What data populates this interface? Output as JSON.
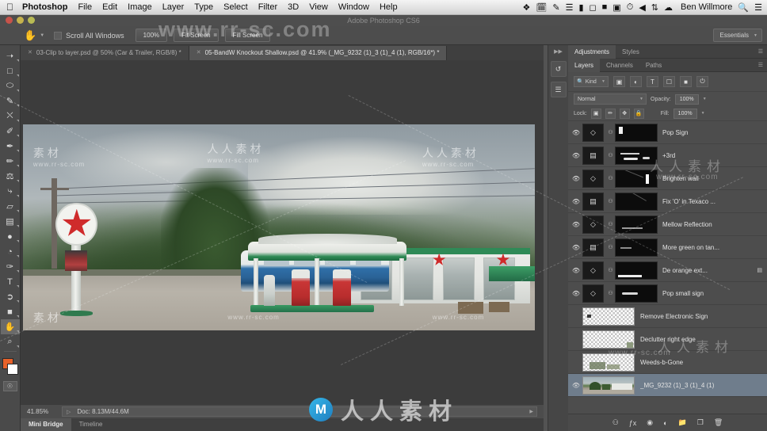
{
  "menubar": {
    "apple_icon": "apple-icon",
    "items": [
      "Photoshop",
      "File",
      "Edit",
      "Image",
      "Layer",
      "Type",
      "Select",
      "Filter",
      "3D",
      "View",
      "Window",
      "Help"
    ],
    "status_icons": [
      "dropbox-icon",
      "calendar-icon",
      "notes-icon",
      "display-icon",
      "battery-icon",
      "cloud-icon",
      "screenshot-icon",
      "clock-icon",
      "volume-icon",
      "bluetooth-icon",
      "wifi-icon"
    ],
    "user": "Ben Willmore",
    "search_icon": "search-icon",
    "notification_icon": "notification-center-icon"
  },
  "app_title": "Adobe Photoshop CS6",
  "options_bar": {
    "tool_icon": "hand-tool-icon",
    "scroll_all_windows_label": "Scroll All Windows",
    "buttons": [
      "100%",
      "Fit Screen",
      "Fill Screen"
    ],
    "workspace": "Essentials"
  },
  "toolbar": {
    "tools": [
      {
        "name": "move-tool",
        "glyph": "↖"
      },
      {
        "name": "marquee-tool",
        "glyph": "⬚"
      },
      {
        "name": "lasso-tool",
        "glyph": "⬭"
      },
      {
        "name": "quick-selection-tool",
        "glyph": "✎"
      },
      {
        "name": "crop-tool",
        "glyph": "⛶"
      },
      {
        "name": "eyedropper-tool",
        "glyph": "✐"
      },
      {
        "name": "spot-healing-brush-tool",
        "glyph": "✒"
      },
      {
        "name": "brush-tool",
        "glyph": "✏"
      },
      {
        "name": "clone-stamp-tool",
        "glyph": "⚓"
      },
      {
        "name": "history-brush-tool",
        "glyph": "⤳"
      },
      {
        "name": "eraser-tool",
        "glyph": "▱"
      },
      {
        "name": "gradient-tool",
        "glyph": "▤"
      },
      {
        "name": "blur-tool",
        "glyph": "●"
      },
      {
        "name": "dodge-tool",
        "glyph": "◔"
      },
      {
        "name": "pen-tool",
        "glyph": "✑"
      },
      {
        "name": "type-tool",
        "glyph": "T"
      },
      {
        "name": "path-selection-tool",
        "glyph": "↖"
      },
      {
        "name": "rectangle-tool",
        "glyph": "■"
      },
      {
        "name": "hand-tool",
        "glyph": "✋"
      },
      {
        "name": "zoom-tool",
        "glyph": "⌕"
      }
    ],
    "foreground_color": "#e8622a",
    "background_color": "#ffffff",
    "quickmask_icon": "quick-mask-icon"
  },
  "tabs": [
    {
      "title": "03-Clip to layer.psd @ 50% (Car & Trailer, RGB/8) *",
      "active": false
    },
    {
      "title": "05-BandW Knockout Shallow.psd @ 41.9% (_MG_9232 (1)_3 (1)_4 (1), RGB/16*) *",
      "active": true
    }
  ],
  "status_bar": {
    "zoom": "41.85%",
    "doc_info": "Doc: 8.13M/44.6M"
  },
  "bottom_tabs": [
    {
      "label": "Mini Bridge",
      "active": true
    },
    {
      "label": "Timeline",
      "active": false
    }
  ],
  "dock_strip": {
    "collapse_icon": "collapse-panels-icon",
    "buttons": [
      "history-panel-icon",
      "properties-panel-icon"
    ]
  },
  "panels": {
    "top_tabs": [
      {
        "label": "Adjustments",
        "active": true
      },
      {
        "label": "Styles",
        "active": false
      }
    ],
    "layer_tabs": [
      {
        "label": "Layers",
        "active": true
      },
      {
        "label": "Channels",
        "active": false
      },
      {
        "label": "Paths",
        "active": false
      }
    ],
    "menu_icon": "panel-menu-icon",
    "filter": {
      "kind_label": "Kind",
      "search_icon": "search-icon",
      "filter_icons": [
        "pixel-filter-icon",
        "adjustment-filter-icon",
        "type-filter-icon",
        "shape-filter-icon",
        "smart-object-filter-icon",
        "toggle-filter-icon"
      ]
    },
    "blend": {
      "mode": "Normal",
      "opacity_label": "Opacity:",
      "opacity_value": "100%"
    },
    "lock": {
      "label": "Lock:",
      "icons": [
        "lock-transparency-icon",
        "lock-image-icon",
        "lock-position-icon",
        "lock-all-icon"
      ],
      "fill_label": "Fill:",
      "fill_value": "100%"
    },
    "layers": [
      {
        "name": "Pop Sign",
        "type": "adjustment",
        "icon": "curves-icon",
        "visible": true,
        "linked": true,
        "masked": true,
        "selected": false
      },
      {
        "name": "+3rd",
        "type": "adjustment",
        "icon": "levels-icon",
        "visible": true,
        "linked": true,
        "masked": true,
        "selected": false
      },
      {
        "name": "Brighten wall",
        "type": "adjustment",
        "icon": "curves-icon",
        "visible": true,
        "linked": true,
        "masked": true,
        "selected": false
      },
      {
        "name": "Fix 'O' in Texaco ...",
        "type": "adjustment",
        "icon": "levels-icon",
        "visible": true,
        "linked": true,
        "masked": true,
        "selected": false
      },
      {
        "name": "Mellow Reflection",
        "type": "adjustment",
        "icon": "curves-icon",
        "visible": true,
        "linked": true,
        "masked": true,
        "selected": false
      },
      {
        "name": "More green on tan...",
        "type": "adjustment",
        "icon": "levels-icon",
        "visible": true,
        "linked": true,
        "masked": true,
        "selected": false
      },
      {
        "name": "De orange ext...",
        "type": "adjustment",
        "icon": "curves-icon",
        "visible": true,
        "linked": true,
        "masked": true,
        "selected": false,
        "has_fx": true
      },
      {
        "name": "Pop small sign",
        "type": "adjustment",
        "icon": "curves-icon",
        "visible": true,
        "linked": true,
        "masked": true,
        "selected": false
      },
      {
        "name": "Remove Electronic Sign",
        "type": "pixel",
        "visible": false,
        "linked": false,
        "masked": false,
        "selected": false
      },
      {
        "name": "Declutter right edge",
        "type": "pixel",
        "visible": false,
        "linked": false,
        "masked": false,
        "selected": false
      },
      {
        "name": "Weeds-b-Gone",
        "type": "pixel",
        "visible": false,
        "linked": false,
        "masked": false,
        "selected": false
      },
      {
        "name": "_MG_9232 (1)_3 (1)_4 (1)",
        "type": "image",
        "visible": true,
        "linked": false,
        "masked": false,
        "selected": true
      }
    ],
    "bottom_buttons": [
      "link-layers-icon",
      "add-style-icon",
      "add-mask-icon",
      "new-adjustment-icon",
      "new-group-icon",
      "new-layer-icon",
      "delete-layer-icon"
    ]
  },
  "watermarks": {
    "cjk": "人人素材",
    "cjk_short": "素材",
    "url": "www.rr-sc.com",
    "top_big": "www.rr-sc.com",
    "logo_letter": "M"
  },
  "colors": {
    "panel_bg": "#4d4d4d",
    "chrome_bg": "#535353",
    "selection": "#6f7d8c",
    "accent_red": "#cf2b2b",
    "accent_green": "#2f8a57",
    "foreground": "#e8622a"
  }
}
